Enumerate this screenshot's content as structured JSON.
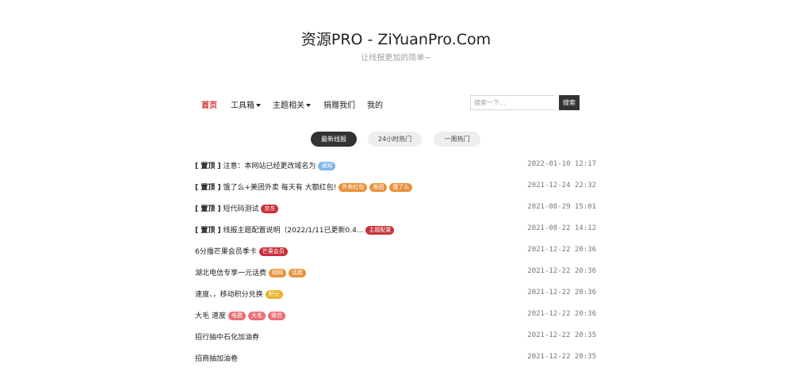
{
  "header": {
    "title": "资源PRO - ZiYuanPro.Com",
    "subtitle": "让线报更加的简单~"
  },
  "nav": {
    "items": [
      {
        "label": "首页",
        "active": true,
        "dropdown": false
      },
      {
        "label": "工具箱",
        "active": false,
        "dropdown": true
      },
      {
        "label": "主题相关",
        "active": false,
        "dropdown": true
      },
      {
        "label": "捐赠我们",
        "active": false,
        "dropdown": false
      },
      {
        "label": "我的",
        "active": false,
        "dropdown": false
      }
    ],
    "search": {
      "placeholder": "搜索一下...",
      "value": "",
      "button_label": "搜索"
    }
  },
  "tabs": [
    {
      "label": "最新线报",
      "active": true
    },
    {
      "label": "24小时热门",
      "active": false
    },
    {
      "label": "一周热门",
      "active": false
    }
  ],
  "colors": {
    "blue": "#7fb7e6",
    "orange": "#e8913b",
    "red": "#c8303a",
    "yellow": "#e9b22a",
    "pink": "#ea6f74",
    "accent": "#d0312d"
  },
  "posts": [
    {
      "pin": "[ 置顶 ]",
      "title": "注意：本网站已经更改域名为",
      "tags": [
        {
          "label": "通知",
          "color": "#7fb7e6"
        }
      ],
      "time": "2022-01-10 12:17"
    },
    {
      "pin": "[ 置顶 ]",
      "title": "饿了么+美团外卖 每天有 大额红包!",
      "tags": [
        {
          "label": "外卖红包",
          "color": "#e8913b"
        },
        {
          "label": "美团",
          "color": "#e8913b"
        },
        {
          "label": "饿了么",
          "color": "#e8913b"
        }
      ],
      "time": "2021-12-24 22:32"
    },
    {
      "pin": "[ 置顶 ]",
      "title": "短代码测试",
      "tags": [
        {
          "label": "京东",
          "color": "#c8303a"
        }
      ],
      "time": "2021-08-29 15:01"
    },
    {
      "pin": "[ 置顶 ]",
      "title": "线报主题配置说明（2022/1/11已更新0.4...",
      "tags": [
        {
          "label": "主题配置",
          "color": "#c8303a"
        }
      ],
      "time": "2021-08-22 14:12"
    },
    {
      "pin": "",
      "title": "6分撸芒果会员季卡",
      "tags": [
        {
          "label": "芒果会员",
          "color": "#c8303a"
        }
      ],
      "time": "2021-12-22 20:36"
    },
    {
      "pin": "",
      "title": "湖北电信专享一元话费",
      "tags": [
        {
          "label": "顺网",
          "color": "#e8913b"
        },
        {
          "label": "话费",
          "color": "#e8913b"
        }
      ],
      "time": "2021-12-22 20:36"
    },
    {
      "pin": "",
      "title": "速度、，移动积分兑换",
      "tags": [
        {
          "label": "积分",
          "color": "#e9b22a"
        }
      ],
      "time": "2021-12-22 20:36"
    },
    {
      "pin": "",
      "title": "大毛 速度",
      "tags": [
        {
          "label": "电费",
          "color": "#ea6f74"
        },
        {
          "label": "大毛",
          "color": "#ea6f74"
        },
        {
          "label": "微信",
          "color": "#ea6f74"
        }
      ],
      "time": "2021-12-22 20:36"
    },
    {
      "pin": "",
      "title": "招行抽中石化加油券",
      "tags": [],
      "time": "2021-12-22 20:35"
    },
    {
      "pin": "",
      "title": "招商抽加油卷",
      "tags": [],
      "time": "2021-12-22 20:35"
    }
  ]
}
